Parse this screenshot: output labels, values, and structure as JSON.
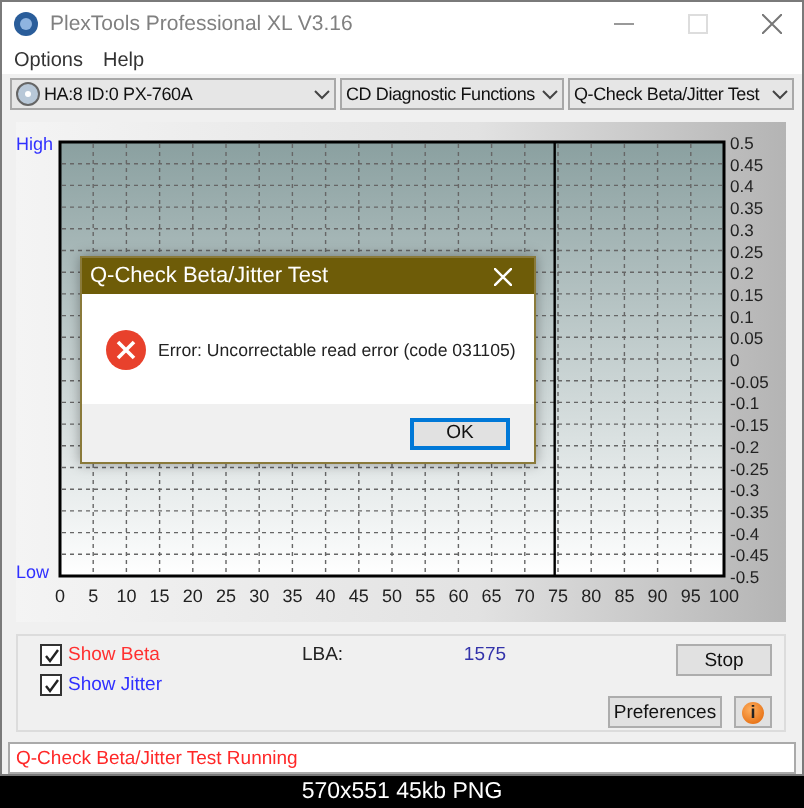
{
  "window": {
    "title": "PlexTools Professional XL V3.16"
  },
  "menu": [
    "Options",
    "Help"
  ],
  "toolbar": {
    "drive": "HA:8 ID:0  PX-760A",
    "function_group": "CD Diagnostic Functions",
    "test": "Q-Check Beta/Jitter Test"
  },
  "chart": {
    "high_label": "High",
    "low_label": "Low",
    "chart_data": {
      "type": "line",
      "xlim": [
        0,
        100
      ],
      "ylim": [
        -0.5,
        0.5
      ],
      "xticks": [
        0,
        5,
        10,
        15,
        20,
        25,
        30,
        35,
        40,
        45,
        50,
        55,
        60,
        65,
        70,
        75,
        80,
        85,
        90,
        95,
        100
      ],
      "yticks": [
        0.5,
        0.45,
        0.4,
        0.35,
        0.3,
        0.25,
        0.2,
        0.15,
        0.1,
        0.05,
        0,
        -0.05,
        -0.1,
        -0.15,
        -0.2,
        -0.25,
        -0.3,
        -0.35,
        -0.4,
        -0.45,
        -0.5
      ],
      "grid": true,
      "ref_lines": [
        {
          "axis": "x",
          "value": 74.5
        }
      ]
    }
  },
  "dialog": {
    "title": "Q-Check Beta/Jitter Test",
    "message": "Error: Uncorrectable read error (code 031105)",
    "button": "OK"
  },
  "controls": {
    "checkboxes": [
      {
        "label": "Show Beta",
        "checked": true,
        "color": "#ff3030"
      },
      {
        "label": "Show Jitter",
        "checked": true,
        "color": "#3030ff"
      }
    ],
    "lba_label": "LBA:",
    "lba_value": "1575",
    "stop": "Stop",
    "preferences": "Preferences",
    "info": "i"
  },
  "status_bar": "Q-Check Beta/Jitter Test Running",
  "caption": "570x551 45kb PNG"
}
